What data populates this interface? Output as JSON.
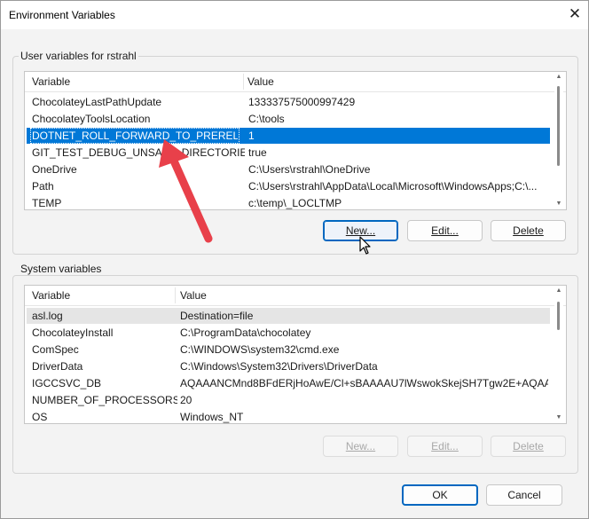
{
  "window": {
    "title": "Environment Variables"
  },
  "user_section": {
    "label": "User variables for rstrahl",
    "columns": [
      "Variable",
      "Value"
    ],
    "rows": [
      {
        "variable": "ChocolateyLastPathUpdate",
        "value": "133337575000997429"
      },
      {
        "variable": "ChocolateyToolsLocation",
        "value": "C:\\tools"
      },
      {
        "variable": "DOTNET_ROLL_FORWARD_TO_PRERELEASE",
        "value": "1",
        "selected": true
      },
      {
        "variable": "GIT_TEST_DEBUG_UNSAFE_DIRECTORIES",
        "value": "true"
      },
      {
        "variable": "OneDrive",
        "value": "C:\\Users\\rstrahl\\OneDrive"
      },
      {
        "variable": "Path",
        "value": "C:\\Users\\rstrahl\\AppData\\Local\\Microsoft\\WindowsApps;C:\\..."
      },
      {
        "variable": "TEMP",
        "value": "c:\\temp\\_LOCLTMP"
      }
    ],
    "buttons": {
      "new": "New...",
      "edit": "Edit...",
      "delete": "Delete"
    }
  },
  "system_section": {
    "label": "System variables",
    "columns": [
      "Variable",
      "Value"
    ],
    "rows": [
      {
        "variable": "asl.log",
        "value": "Destination=file"
      },
      {
        "variable": "ChocolateyInstall",
        "value": "C:\\ProgramData\\chocolatey"
      },
      {
        "variable": "ComSpec",
        "value": "C:\\WINDOWS\\system32\\cmd.exe"
      },
      {
        "variable": "DriverData",
        "value": "C:\\Windows\\System32\\Drivers\\DriverData"
      },
      {
        "variable": "IGCCSVC_DB",
        "value": "AQAAANCMnd8BFdERjHoAwE/Cl+sBAAAAU7lWswokSkejSH7Tgw2E+AQAA..."
      },
      {
        "variable": "NUMBER_OF_PROCESSORS",
        "value": "20"
      },
      {
        "variable": "OS",
        "value": "Windows_NT"
      }
    ],
    "buttons": {
      "new": "New...",
      "edit": "Edit...",
      "delete": "Delete"
    }
  },
  "footer": {
    "ok": "OK",
    "cancel": "Cancel"
  },
  "colors": {
    "selection": "#0078d7",
    "accent": "#0067c0",
    "annotation_arrow": "#e8404a"
  },
  "icons": [
    "close-icon",
    "mouse-cursor-icon",
    "annotation-arrow-icon"
  ]
}
